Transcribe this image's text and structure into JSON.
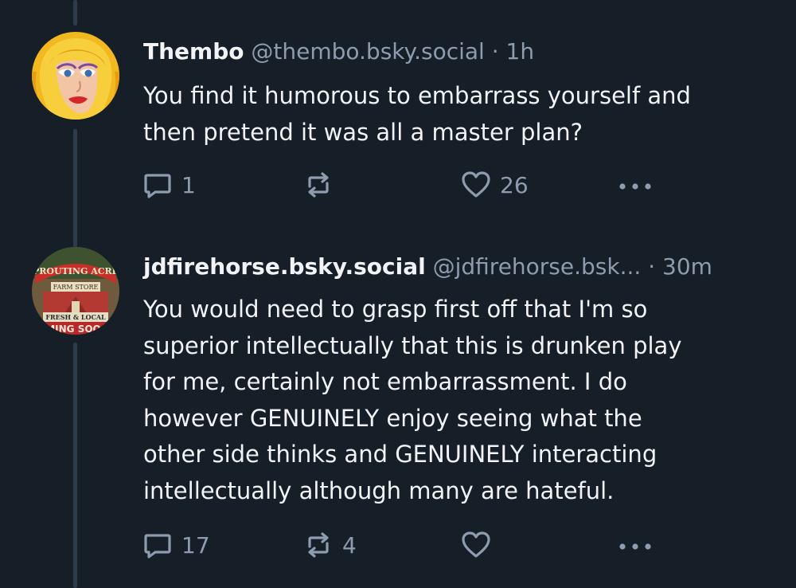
{
  "posts": [
    {
      "display_name": "Thembo",
      "handle": "@thembo.bsky.social",
      "separator": "·",
      "time": "1h",
      "text": "You find it humorous to embarrass yourself and\nthen pretend it was all a master plan?",
      "reply_count": "1",
      "repost_count": "",
      "like_count": "26",
      "avatar_icon": "cartoon-woman-avatar"
    },
    {
      "display_name": "jdfirehorse.bsky.social",
      "handle": "@jdfirehorse.bsk...",
      "separator": "·",
      "time": "30m",
      "text": "You would need to grasp first off that I'm so\nsuperior intellectually that this is drunken play\nfor me, certainly not embarrassment.  I do\nhowever GENUINELY  enjoy seeing what the\nother side thinks and GENUINELY interacting\nintellectually although many are hateful.",
      "reply_count": "17",
      "repost_count": "4",
      "like_count": "",
      "avatar_icon": "farm-store-sign-avatar",
      "avatar_text": {
        "line1": "SPROUTING ACRES",
        "line2": "FARM STORE",
        "line3": "FRESH & LOCAL",
        "line4": "MING SOO"
      }
    }
  ],
  "colors": {
    "background": "#161e27",
    "text": "#f1f3f5",
    "muted": "#8d9cae",
    "thread_line": "#2e3b4b"
  },
  "icons": [
    "reply-icon",
    "repost-icon",
    "like-icon",
    "more-icon"
  ]
}
